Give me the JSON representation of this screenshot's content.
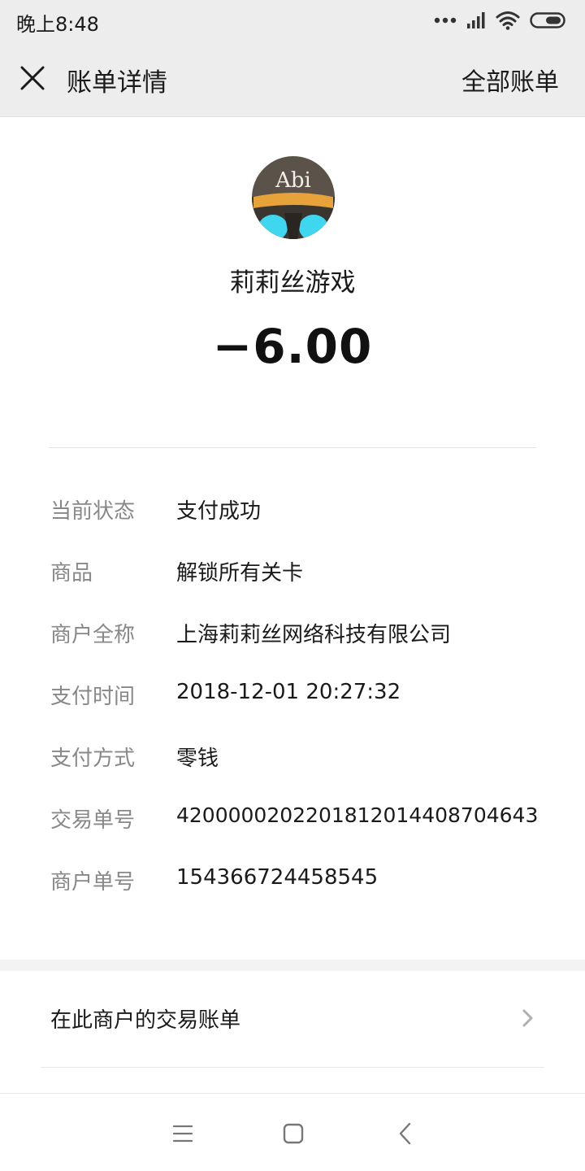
{
  "status_bar": {
    "time": "晚上8:48"
  },
  "header": {
    "title": "账单详情",
    "right_action": "全部账单"
  },
  "merchant": {
    "avatar_text": "Abi",
    "name": "莉莉丝游戏"
  },
  "amount": "−6.00",
  "details": [
    {
      "label": "当前状态",
      "value": "支付成功"
    },
    {
      "label": "商品",
      "value": "解锁所有关卡"
    },
    {
      "label": "商户全称",
      "value": "上海莉莉丝网络科技有限公司"
    },
    {
      "label": "支付时间",
      "value": "2018-12-01 20:27:32"
    },
    {
      "label": "支付方式",
      "value": "零钱"
    },
    {
      "label": "交易单号",
      "value": "4200000202201812014408704643"
    },
    {
      "label": "商户单号",
      "value": "154366724458545"
    }
  ],
  "merchant_bills_link": "在此商户的交易账单",
  "colors": {
    "nav_bg": "#ededed",
    "label_gray": "#888888",
    "avatar_ring": "#e7a23a",
    "avatar_eyes": "#3fd6f0"
  },
  "icons": [
    "signal-icon",
    "wifi-icon",
    "battery-icon",
    "close-icon",
    "chevron-right-icon",
    "menu-icon",
    "home-icon",
    "back-icon"
  ]
}
